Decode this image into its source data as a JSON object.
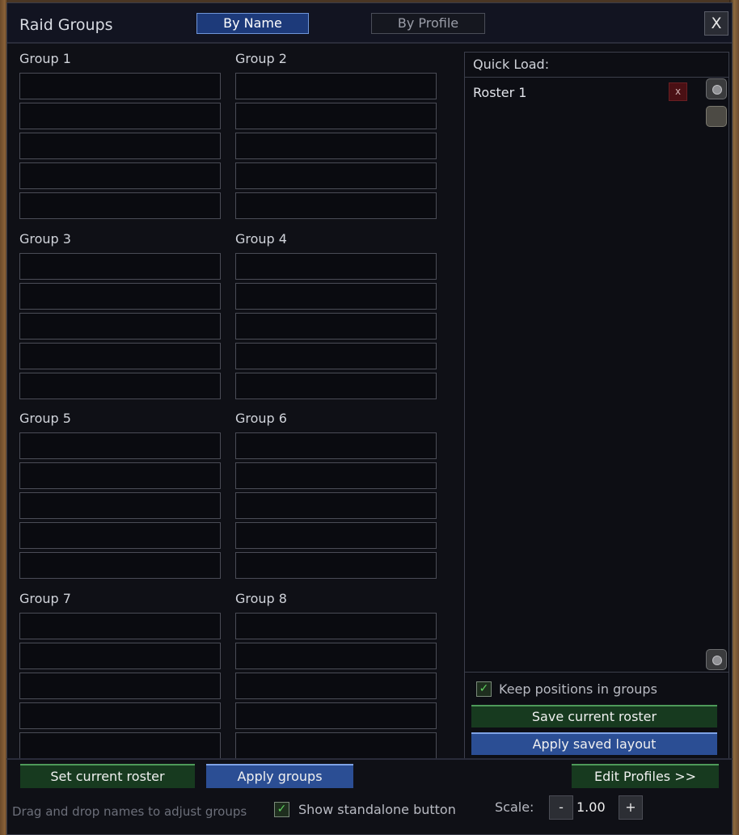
{
  "window": {
    "title": "Raid Groups",
    "close_label": "X"
  },
  "tabs": [
    {
      "label": "By Name",
      "active": true
    },
    {
      "label": "By Profile",
      "active": false
    }
  ],
  "groups": [
    {
      "label": "Group 1"
    },
    {
      "label": "Group 2"
    },
    {
      "label": "Group 3"
    },
    {
      "label": "Group 4"
    },
    {
      "label": "Group 5"
    },
    {
      "label": "Group 6"
    },
    {
      "label": "Group 7"
    },
    {
      "label": "Group 8"
    }
  ],
  "quick_load": {
    "header": "Quick Load:",
    "rosters": [
      {
        "name": "Roster 1",
        "delete_label": "x"
      }
    ],
    "keep_positions": {
      "label": "Keep positions in groups",
      "checked": true,
      "check_glyph": "✓"
    },
    "save_button": "Save current roster",
    "apply_button": "Apply saved layout"
  },
  "bottom": {
    "set_roster_button": "Set current roster",
    "apply_groups_button": "Apply groups",
    "edit_profiles_button": "Edit Profiles >>",
    "hint": "Drag and drop names to adjust groups",
    "standalone": {
      "label": "Show standalone button",
      "checked": true,
      "check_glyph": "✓"
    },
    "scale": {
      "label": "Scale:",
      "decrement": "-",
      "value": "1.00",
      "increment": "+"
    }
  },
  "colors": {
    "frame_bg": "#0f1016",
    "active_tab": "#1d3a7a",
    "green_button": "#173a1f",
    "blue_button": "#2b4e94",
    "delete_red": "#4a1014"
  }
}
